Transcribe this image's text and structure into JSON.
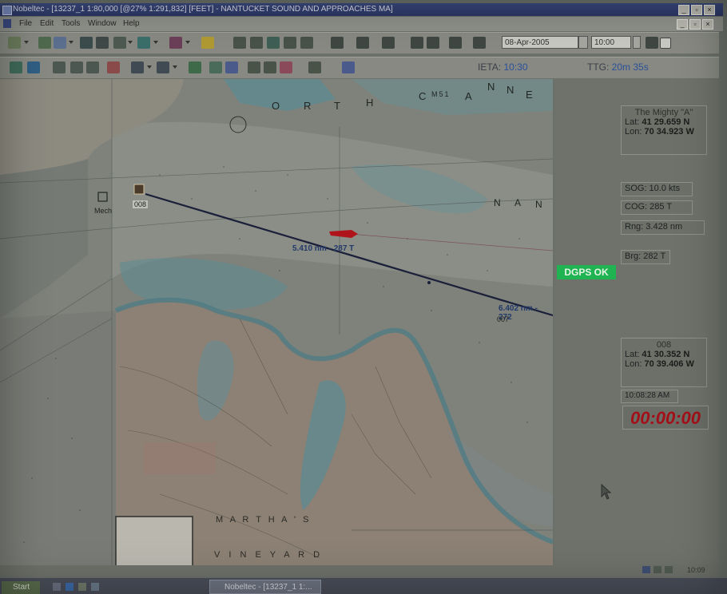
{
  "window": {
    "app_name": "Nobeltec",
    "title": "Nobeltec - [13237_1 1:80,000 [@27% 1:291,832] [FEET] - NANTUCKET SOUND AND APPROACHES MA]",
    "controls": [
      "minimize",
      "restore",
      "close"
    ]
  },
  "menubar": {
    "items": [
      "File",
      "Edit",
      "Tools",
      "Window",
      "Help"
    ]
  },
  "toolbar": {
    "date_value": "08-Apr-2005",
    "time_value": "10:00",
    "eta_label": "IETA:",
    "eta_value": "10:30",
    "ttg_label": "TTG:",
    "ttg_value": "20m 35s"
  },
  "chart": {
    "top_labels": [
      "O",
      "R",
      "T",
      "H",
      "C",
      "M51",
      "A",
      "N",
      "N",
      "E"
    ],
    "nan_label": [
      "N",
      "A",
      "N"
    ],
    "waypoint_label": "008",
    "boat_label": "Mech",
    "leg1_label": "5.410 nm - 287 T",
    "leg2_label": "6.402 nm - 272",
    "leg2_sub": "007",
    "marthas_label": "M A R T H A ' S",
    "vineyard_label": "V I N E Y A R D"
  },
  "vessel_panel": {
    "name": "The Mighty \"A\"",
    "lat_label": "Lat:",
    "lat_value": "41 29.659 N",
    "lon_label": "Lon:",
    "lon_value": "70 34.923 W",
    "sog": "SOG: 10.0 kts",
    "cog": "COG: 285 T",
    "rng": "Rng: 3.428 nm",
    "brg": "Brg: 282 T"
  },
  "dgps_status": "DGPS OK",
  "waypoint_panel": {
    "name": "008",
    "lat_label": "Lat:",
    "lat_value": "41 30.352 N",
    "lon_label": "Lon:",
    "lon_value": "70 39.406 W",
    "time": "10:08:28 AM",
    "timer": "00:00:00"
  },
  "taskbar": {
    "start_label": "Start",
    "task_label": "Nobeltec - [13237_1 1:...",
    "clock": "10:09"
  },
  "colors": {
    "titlebar": "#2b3766",
    "dgps": "#1fb351",
    "timer": "#a30f18",
    "route": "#1a1f3a",
    "vessel": "#b0141b"
  }
}
